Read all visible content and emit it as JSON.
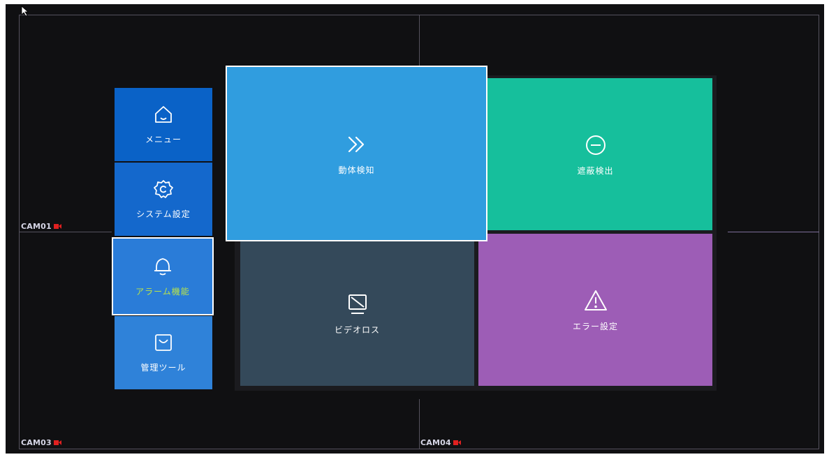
{
  "cameras": [
    {
      "label": "CAM01"
    },
    {
      "label": "CAM03"
    },
    {
      "label": "CAM04"
    }
  ],
  "sidebar": {
    "items": [
      {
        "label": "メニュー",
        "icon": "home-icon",
        "color": "#0a62c7",
        "selected": false
      },
      {
        "label": "システム設定",
        "icon": "gear-icon",
        "color": "#1468cc",
        "selected": false
      },
      {
        "label": "アラーム機能",
        "icon": "bell-icon",
        "color": "#2a7cd8",
        "selected": true
      },
      {
        "label": "管理ツール",
        "icon": "toolbox-icon",
        "color": "#2f82d9",
        "selected": false
      }
    ]
  },
  "tiles": [
    {
      "label": "動体検知",
      "icon": "double-chevron-right-icon",
      "color": "#309ddf",
      "selected": true
    },
    {
      "label": "遮蔽検出",
      "icon": "minus-circle-icon",
      "color": "#16bf9c",
      "selected": false
    },
    {
      "label": "ビデオロス",
      "icon": "monitor-slash-icon",
      "color": "#34495a",
      "selected": false
    },
    {
      "label": "エラー設定",
      "icon": "warning-triangle-icon",
      "color": "#9d5db6",
      "selected": false
    }
  ],
  "colors": {
    "background": "#101012",
    "grid_line": "#55525e",
    "selected_text": "#b9e44a",
    "record_icon": "#e02020"
  }
}
